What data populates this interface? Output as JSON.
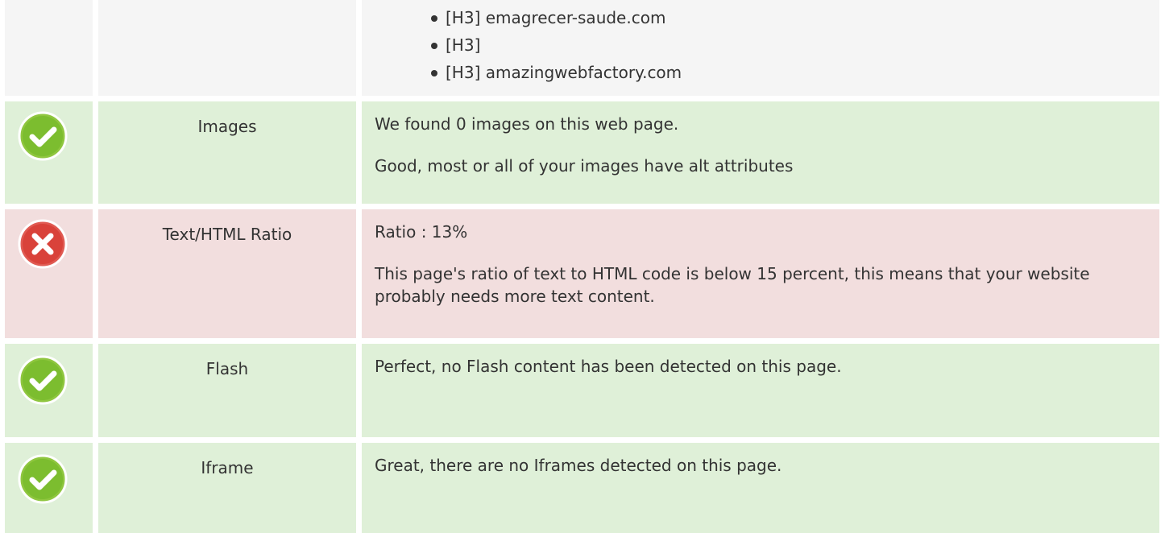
{
  "headings": {
    "items": [
      "[H3] emagrecer-saude.com",
      "[H3]",
      "[H3] amazingwebfactory.com"
    ]
  },
  "checks": [
    {
      "status": "pass",
      "icon": "check-icon",
      "label": "Images",
      "lines": [
        "We found 0 images on this web page.",
        "Good, most or all of your images have alt attributes"
      ]
    },
    {
      "status": "fail",
      "icon": "cross-icon",
      "label": "Text/HTML Ratio",
      "lines": [
        "Ratio : 13%",
        "This page's ratio of text to HTML code is below 15 percent, this means that your website probably needs more text content."
      ]
    },
    {
      "status": "pass",
      "icon": "check-icon",
      "label": "Flash",
      "lines": [
        "Perfect, no Flash content has been detected on this page."
      ]
    },
    {
      "status": "pass",
      "icon": "check-icon",
      "label": "Iframe",
      "lines": [
        "Great, there are no Iframes detected on this page."
      ]
    }
  ],
  "colors": {
    "pass_bg": "#dff0d8",
    "fail_bg": "#f2dede",
    "neutral_bg": "#f5f5f5",
    "pass_icon": "#7cbd2f",
    "fail_icon": "#d9423a"
  }
}
